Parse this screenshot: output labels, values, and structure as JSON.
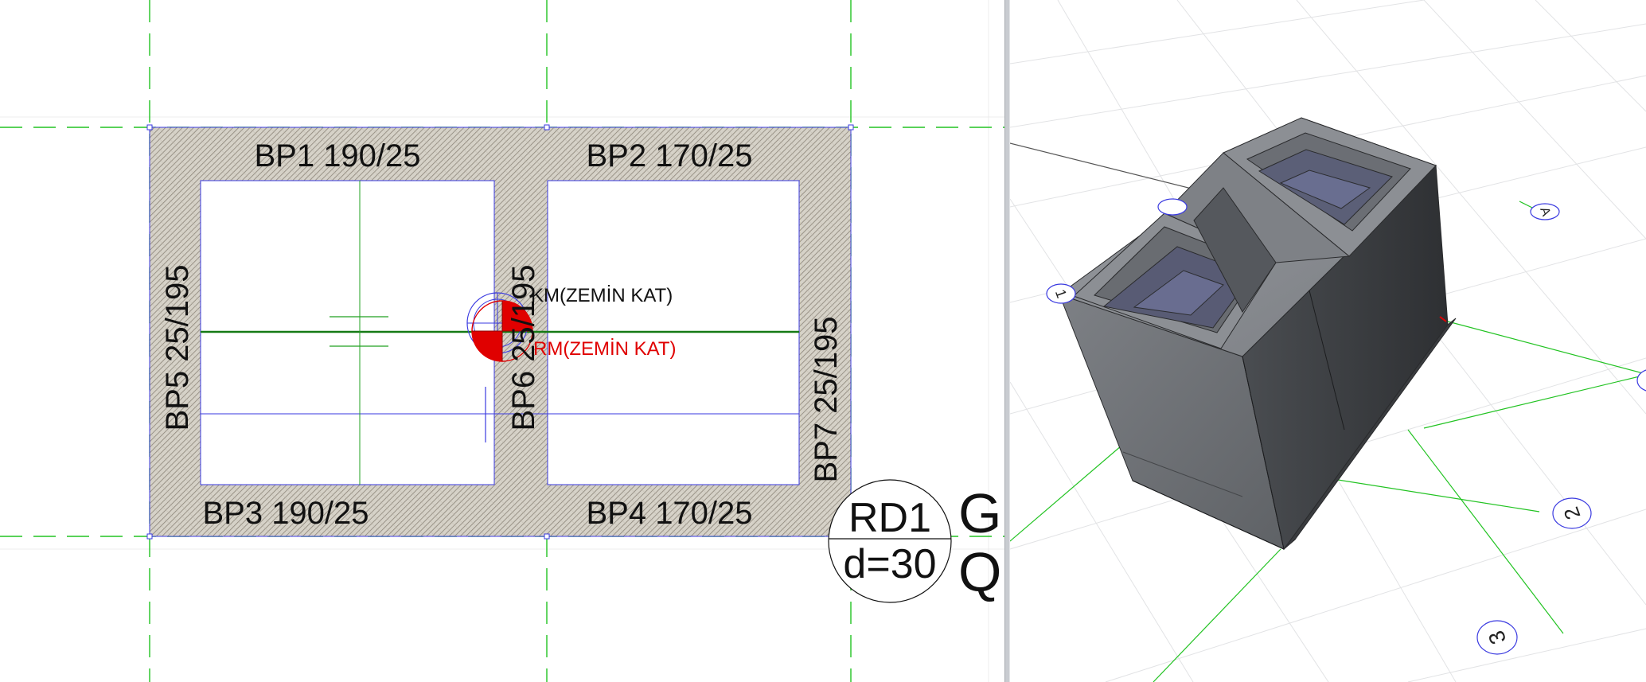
{
  "plan": {
    "walls": [
      {
        "id": "bp1",
        "label": "BP1 190/25"
      },
      {
        "id": "bp2",
        "label": "BP2 170/25"
      },
      {
        "id": "bp3",
        "label": "BP3 190/25"
      },
      {
        "id": "bp4",
        "label": "BP4 170/25"
      },
      {
        "id": "bp5",
        "label": "BP5 25/195"
      },
      {
        "id": "bp6",
        "label": "BP6 25/195"
      },
      {
        "id": "bp7",
        "label": "BP7 25/195"
      }
    ],
    "mass_center_label": "KM(ZEMİN KAT)",
    "rigidity_center_label": "RM(ZEMİN KAT)",
    "slab": {
      "name": "RD1",
      "thickness": "d=30"
    },
    "load_labels": {
      "g": "G:",
      "q": "Q:"
    }
  },
  "model": {
    "axis_bubbles": {
      "a": "A",
      "one": "1",
      "two": "2",
      "three": "3"
    },
    "hidden_bubble": ""
  },
  "colors": {
    "axis_green": "#22c322",
    "selection_blue": "#3a3ae0",
    "wall_hatch": "#8a8377",
    "rigidity_red": "#e00000",
    "model_solid": "#6f7276"
  }
}
